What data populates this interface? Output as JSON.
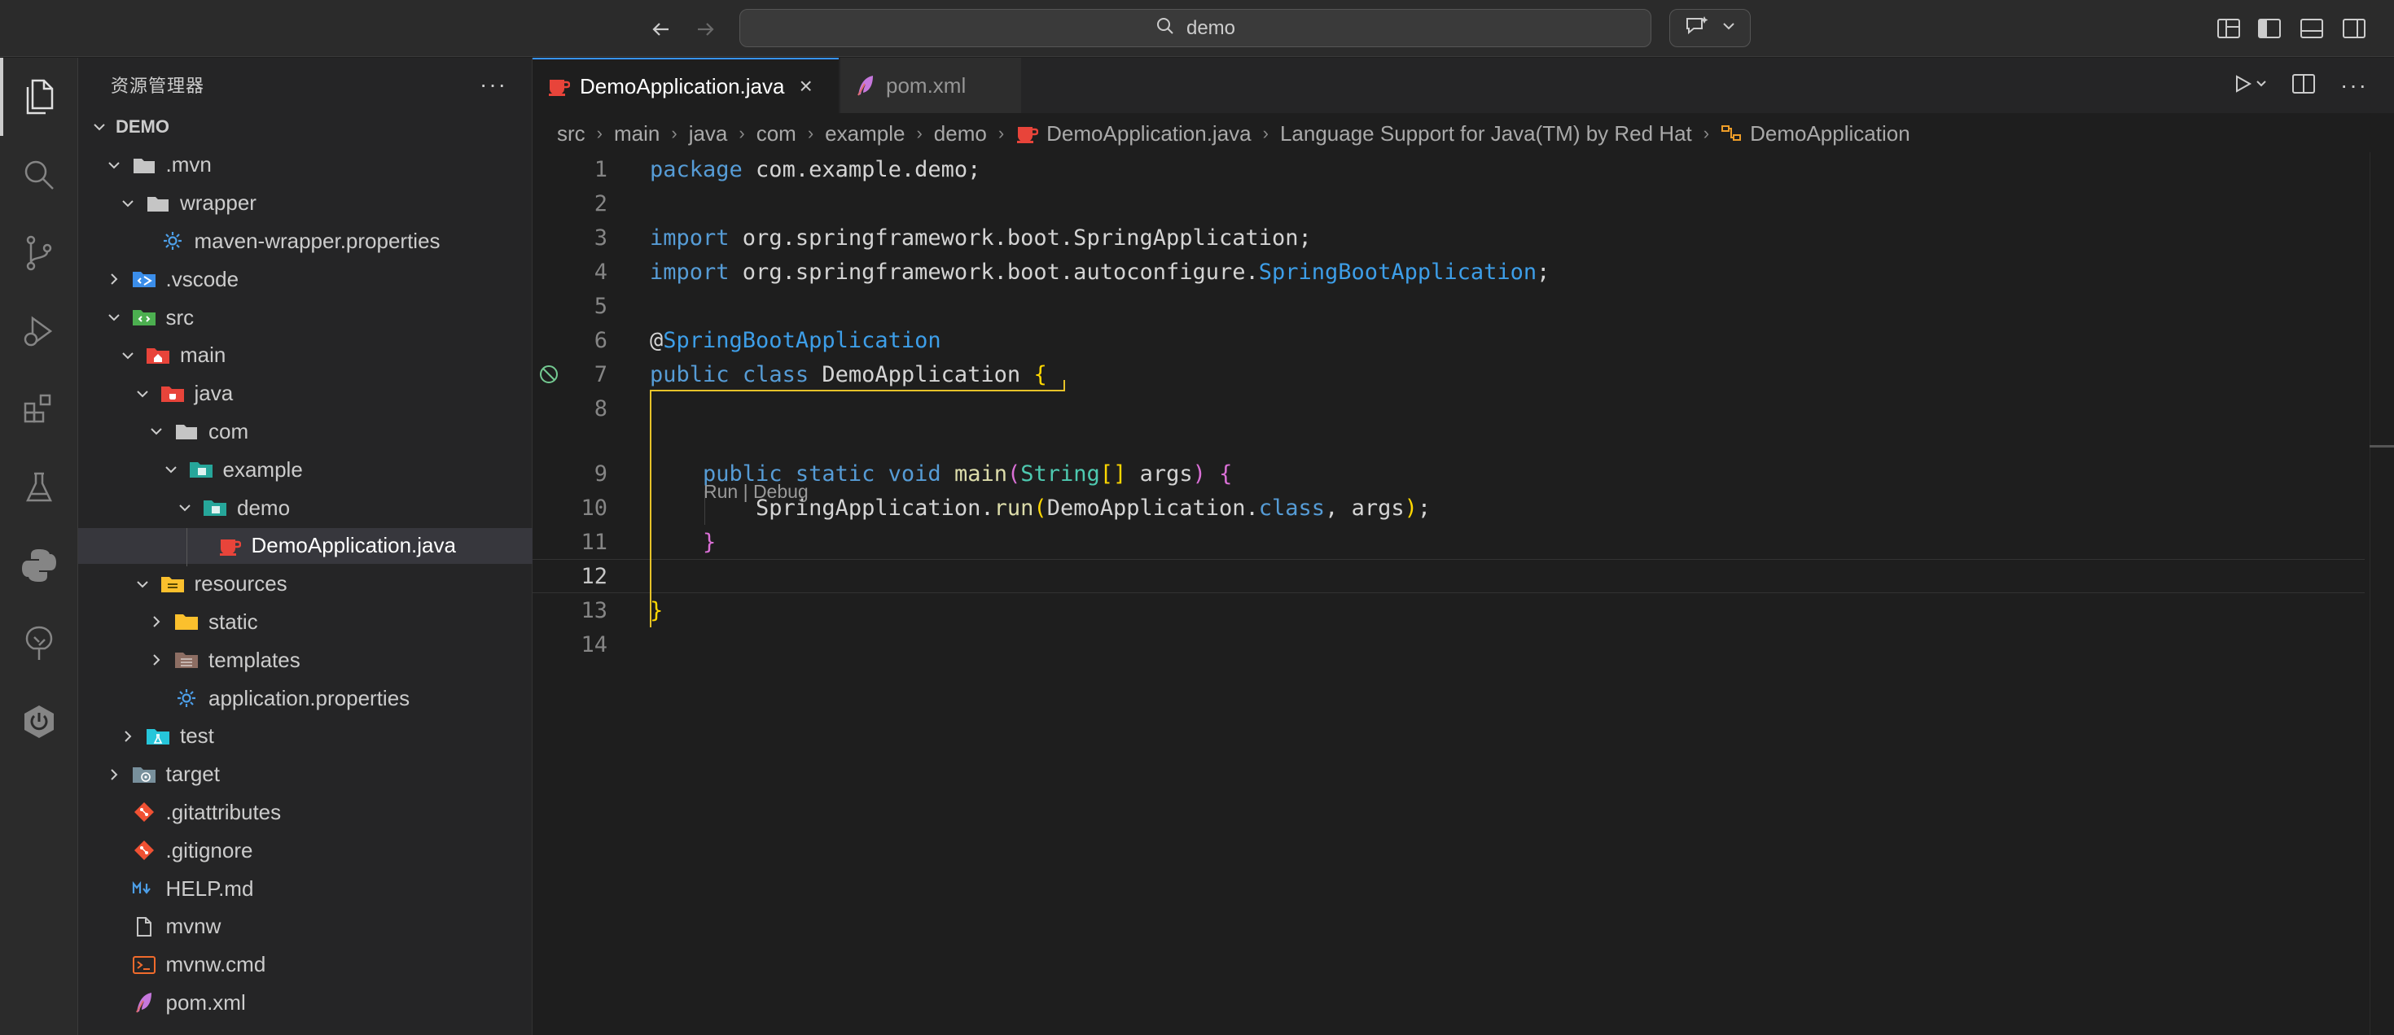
{
  "titlebar": {
    "search_text": "demo"
  },
  "sidebar": {
    "title": "资源管理器",
    "more": "···",
    "tree": [
      {
        "label": "DEMO",
        "level": 0,
        "type": "root",
        "expanded": true
      },
      {
        "label": ".mvn",
        "level": 1,
        "type": "folder",
        "expanded": true
      },
      {
        "label": "wrapper",
        "level": 2,
        "type": "folder",
        "expanded": true
      },
      {
        "label": "maven-wrapper.properties",
        "level": 3,
        "type": "gear"
      },
      {
        "label": ".vscode",
        "level": 1,
        "type": "vscode-folder",
        "expanded": false
      },
      {
        "label": "src",
        "level": 1,
        "type": "src-folder",
        "expanded": true
      },
      {
        "label": "main",
        "level": 2,
        "type": "main-folder",
        "expanded": true
      },
      {
        "label": "java",
        "level": 3,
        "type": "java-folder",
        "expanded": true
      },
      {
        "label": "com",
        "level": 4,
        "type": "folder",
        "expanded": true
      },
      {
        "label": "example",
        "level": 5,
        "type": "pkg-folder",
        "expanded": true
      },
      {
        "label": "demo",
        "level": 6,
        "type": "pkg-folder",
        "expanded": true
      },
      {
        "label": "DemoApplication.java",
        "level": 7,
        "type": "java-file",
        "selected": true
      },
      {
        "label": "resources",
        "level": 3,
        "type": "res-folder",
        "expanded": true
      },
      {
        "label": "static",
        "level": 4,
        "type": "static-folder",
        "expanded": false
      },
      {
        "label": "templates",
        "level": 4,
        "type": "tpl-folder",
        "expanded": false
      },
      {
        "label": "application.properties",
        "level": 4,
        "type": "gear"
      },
      {
        "label": "test",
        "level": 2,
        "type": "test-folder",
        "expanded": false
      },
      {
        "label": "target",
        "level": 1,
        "type": "target-folder",
        "expanded": false
      },
      {
        "label": ".gitattributes",
        "level": 1,
        "type": "git"
      },
      {
        "label": ".gitignore",
        "level": 1,
        "type": "git"
      },
      {
        "label": "HELP.md",
        "level": 1,
        "type": "md"
      },
      {
        "label": "mvnw",
        "level": 1,
        "type": "file"
      },
      {
        "label": "mvnw.cmd",
        "level": 1,
        "type": "cmd"
      },
      {
        "label": "pom.xml",
        "level": 1,
        "type": "xml"
      }
    ]
  },
  "tabs": [
    {
      "label": "DemoApplication.java",
      "active": true,
      "close": "×"
    },
    {
      "label": "pom.xml",
      "active": false
    }
  ],
  "breadcrumb": [
    "src",
    "main",
    "java",
    "com",
    "example",
    "demo",
    "DemoApplication.java",
    "Language Support for Java(TM) by Red Hat",
    "DemoApplication"
  ],
  "breadcrumb_sep": "›",
  "editor": {
    "current_line": 12,
    "codelens": "Run | Debug",
    "line_numbers": [
      "1",
      "2",
      "3",
      "4",
      "5",
      "6",
      "7",
      "8",
      "9",
      "10",
      "11",
      "12",
      "13",
      "14"
    ],
    "lines": {
      "l1": [
        {
          "t": "package",
          "c": "kw"
        },
        {
          "t": " com.example.demo;",
          "c": ""
        }
      ],
      "l3": [
        {
          "t": "import",
          "c": "kw"
        },
        {
          "t": " org.springframework.boot.SpringApplication;",
          "c": ""
        }
      ],
      "l4": [
        {
          "t": "import",
          "c": "kw"
        },
        {
          "t": " org.springframework.boot.autoconfigure.",
          "c": ""
        },
        {
          "t": "SpringBootApplication",
          "c": "ann"
        },
        {
          "t": ";",
          "c": ""
        }
      ],
      "l6": [
        {
          "t": "@",
          "c": ""
        },
        {
          "t": "SpringBootApplication",
          "c": "ann"
        }
      ],
      "l7": [
        {
          "t": "public",
          "c": "kw"
        },
        {
          "t": " ",
          "c": ""
        },
        {
          "t": "class",
          "c": "kw"
        },
        {
          "t": " DemoApplication ",
          "c": ""
        },
        {
          "t": "{",
          "c": "br1"
        }
      ],
      "l9": [
        {
          "t": "    ",
          "c": ""
        },
        {
          "t": "public",
          "c": "kw"
        },
        {
          "t": " ",
          "c": ""
        },
        {
          "t": "static",
          "c": "kw"
        },
        {
          "t": " ",
          "c": ""
        },
        {
          "t": "void",
          "c": "kw"
        },
        {
          "t": " ",
          "c": ""
        },
        {
          "t": "main",
          "c": "fn"
        },
        {
          "t": "(",
          "c": "br2"
        },
        {
          "t": "String",
          "c": "cls"
        },
        {
          "t": "[]",
          "c": "br1"
        },
        {
          "t": " args",
          "c": ""
        },
        {
          "t": ")",
          "c": "br2"
        },
        {
          "t": " ",
          "c": ""
        },
        {
          "t": "{",
          "c": "br2"
        }
      ],
      "l10": [
        {
          "t": "        SpringApplication.",
          "c": ""
        },
        {
          "t": "run",
          "c": "fn"
        },
        {
          "t": "(",
          "c": "br1"
        },
        {
          "t": "DemoApplication.",
          "c": ""
        },
        {
          "t": "class",
          "c": "kw"
        },
        {
          "t": ", args",
          "c": ""
        },
        {
          "t": ")",
          "c": "br1"
        },
        {
          "t": ";",
          "c": ""
        }
      ],
      "l11": [
        {
          "t": "    ",
          "c": ""
        },
        {
          "t": "}",
          "c": "br2"
        }
      ],
      "l13": [
        {
          "t": "}",
          "c": "br1"
        }
      ]
    }
  },
  "colors": {
    "accent": "#3794ff",
    "keyword": "#569cd6",
    "bracket_gold": "#ffd700",
    "bracket_magenta": "#da70d6",
    "java_icon": "#e8443a",
    "pom_icon": "#c678dd"
  }
}
